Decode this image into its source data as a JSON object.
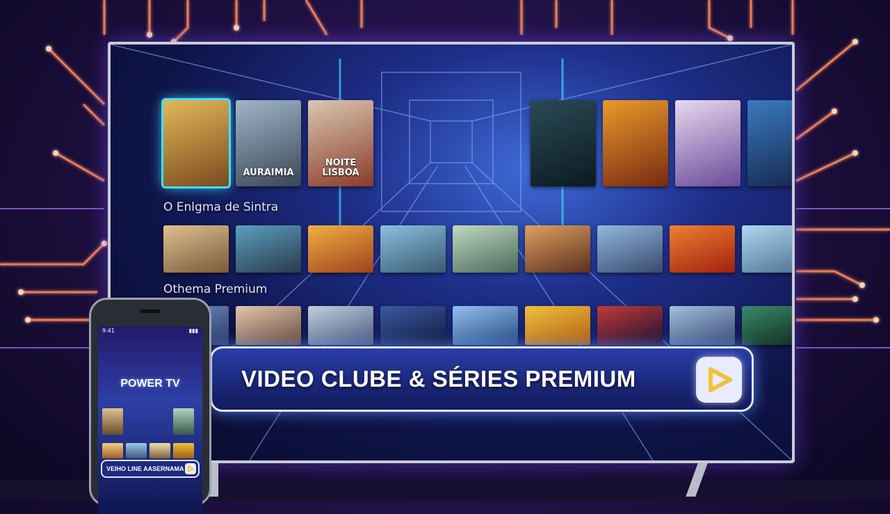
{
  "tv": {
    "sections": [
      {
        "title": "O Enlgma de Sintra"
      },
      {
        "title": "Othema Premium"
      }
    ],
    "row1": [
      {
        "title": "",
        "colors": [
          "#e3b85a",
          "#7a4a1e"
        ],
        "selected": true
      },
      {
        "title": "AURAIMIA",
        "colors": [
          "#9fb6c9",
          "#3a4656"
        ],
        "selected": false
      },
      {
        "title": "NOITE LISBOA",
        "colors": [
          "#d9c8b0",
          "#8a3b2a"
        ],
        "selected": false
      },
      {
        "title": "",
        "colors": [
          "#2a4a55",
          "#0c1a22"
        ],
        "selected": false
      },
      {
        "title": "",
        "colors": [
          "#e89a2a",
          "#7a2a12"
        ],
        "selected": false
      },
      {
        "title": "",
        "colors": [
          "#e7d8ee",
          "#6a4a9a"
        ],
        "selected": false
      },
      {
        "title": "",
        "colors": [
          "#3a7ac0",
          "#14264a"
        ],
        "selected": false
      }
    ],
    "row2": [
      {
        "colors": [
          "#e0c090",
          "#7a5a3a"
        ]
      },
      {
        "colors": [
          "#5aa0c0",
          "#2a3a4a"
        ]
      },
      {
        "colors": [
          "#f0b040",
          "#a04020"
        ]
      },
      {
        "colors": [
          "#8ac0e0",
          "#3a5a70"
        ]
      },
      {
        "colors": [
          "#c0d8c0",
          "#4a6a5a"
        ]
      },
      {
        "colors": [
          "#e0a060",
          "#5a3020"
        ]
      },
      {
        "colors": [
          "#90b8e0",
          "#3a4a6a"
        ]
      },
      {
        "colors": [
          "#f08030",
          "#a02010"
        ]
      },
      {
        "colors": [
          "#b0d8f0",
          "#4a7090"
        ]
      }
    ],
    "row3": [
      {
        "colors": [
          "#7090c0",
          "#2a3a6a"
        ]
      },
      {
        "colors": [
          "#e0c8b0",
          "#6a4a3a"
        ]
      },
      {
        "colors": [
          "#c0d0e0",
          "#4a5a7a"
        ]
      },
      {
        "colors": [
          "#3a5aa0",
          "#121a40"
        ]
      },
      {
        "colors": [
          "#90c0f0",
          "#2a4a80"
        ]
      },
      {
        "colors": [
          "#f0c040",
          "#b06010"
        ]
      },
      {
        "colors": [
          "#c03a3a",
          "#201030"
        ]
      },
      {
        "colors": [
          "#a0c0e0",
          "#3a4a70"
        ]
      },
      {
        "colors": [
          "#3a8a6a",
          "#102a20"
        ]
      }
    ]
  },
  "banner": {
    "text": "VIDEO CLUBE & SÉRIES PREMIUM"
  },
  "phone": {
    "title": "POWER TV",
    "banner_text": "VEIHO LINE AASERNAMA",
    "status_time": "9:41"
  },
  "icons": {
    "play": "play-triangle-icon"
  },
  "colors": {
    "accent_cyan": "#3fe0ff",
    "play_triangle": "#f0c23a",
    "banner_bg": "#1a2778",
    "circuit_glow": "#ff7a3a"
  }
}
